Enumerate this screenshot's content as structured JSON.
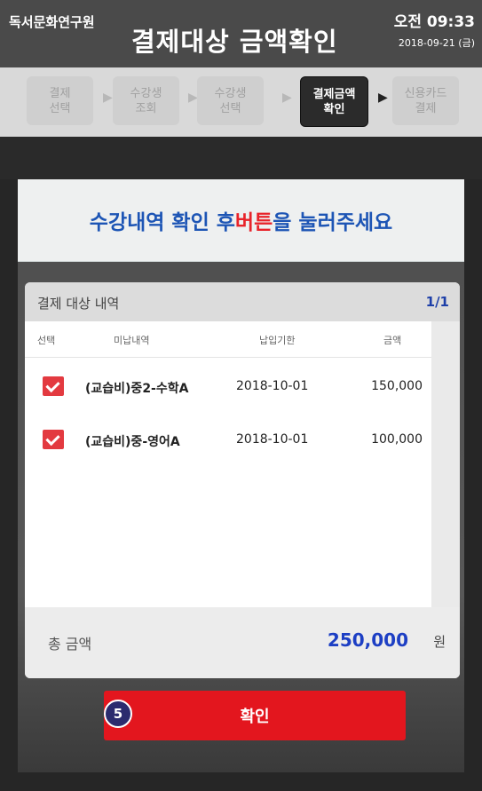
{
  "header": {
    "org_name": "독서문화연구원",
    "title": "결제대상 금액확인",
    "time": "오전 09:33",
    "date": "2018-09-21 (금)"
  },
  "steps": [
    {
      "label": "결제\n선택",
      "active": false
    },
    {
      "label": "수강생\n조회",
      "active": false
    },
    {
      "label": "수강생\n선택",
      "active": false
    },
    {
      "label": "결제금액\n확인",
      "active": true
    },
    {
      "label": "신용카드\n결제",
      "active": false
    }
  ],
  "instruction": {
    "before": "수강내역 확인 후 ",
    "highlight": "버튼",
    "after": "을 눌러주세요"
  },
  "panel": {
    "title": "결제 대상 내역",
    "page": "1/1",
    "columns": [
      "선택",
      "미납내역",
      "납입기한",
      "금액"
    ],
    "rows": [
      {
        "item": "(교습비)중2-수학A",
        "due": "2018-10-01",
        "amount": "150,000",
        "checked": true
      },
      {
        "item": "(교습비)중-영어A",
        "due": "2018-10-01",
        "amount": "100,000",
        "checked": true
      }
    ]
  },
  "total": {
    "label": "총 금액",
    "value": "250,000",
    "unit": "원"
  },
  "confirm_button": {
    "label": "확인",
    "badge": "5"
  },
  "colors": {
    "accent_blue": "#1d55b5",
    "accent_red": "#e3161e",
    "checkbox_red": "#e33a40",
    "total_blue": "#1d3fc4"
  }
}
